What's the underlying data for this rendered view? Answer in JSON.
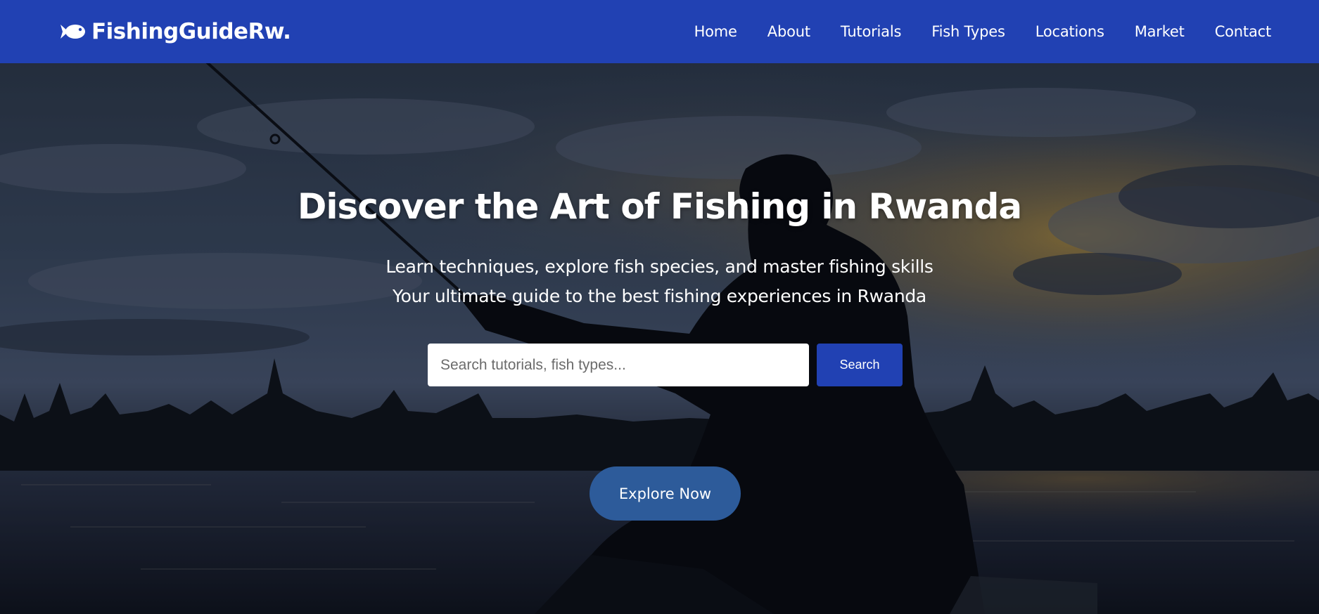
{
  "brand": {
    "icon": "fish-icon",
    "name": "FishingGuideRw."
  },
  "nav": {
    "items": [
      {
        "label": "Home"
      },
      {
        "label": "About"
      },
      {
        "label": "Tutorials"
      },
      {
        "label": "Fish Types"
      },
      {
        "label": "Locations"
      },
      {
        "label": "Market"
      },
      {
        "label": "Contact"
      }
    ]
  },
  "hero": {
    "title": "Discover the Art of Fishing in Rwanda",
    "subtitle_line1": "Learn techniques, explore fish species, and master fishing skills",
    "subtitle_line2": "Your ultimate guide to the best fishing experiences in Rwanda",
    "search": {
      "placeholder": "Search tutorials, fish types...",
      "value": "",
      "button_label": "Search"
    },
    "cta_label": "Explore Now"
  },
  "colors": {
    "navbar_bg": "#2141b3",
    "search_button_bg": "#2141b3",
    "cta_bg": "#2d5b9a",
    "text_light": "#ffffff"
  }
}
